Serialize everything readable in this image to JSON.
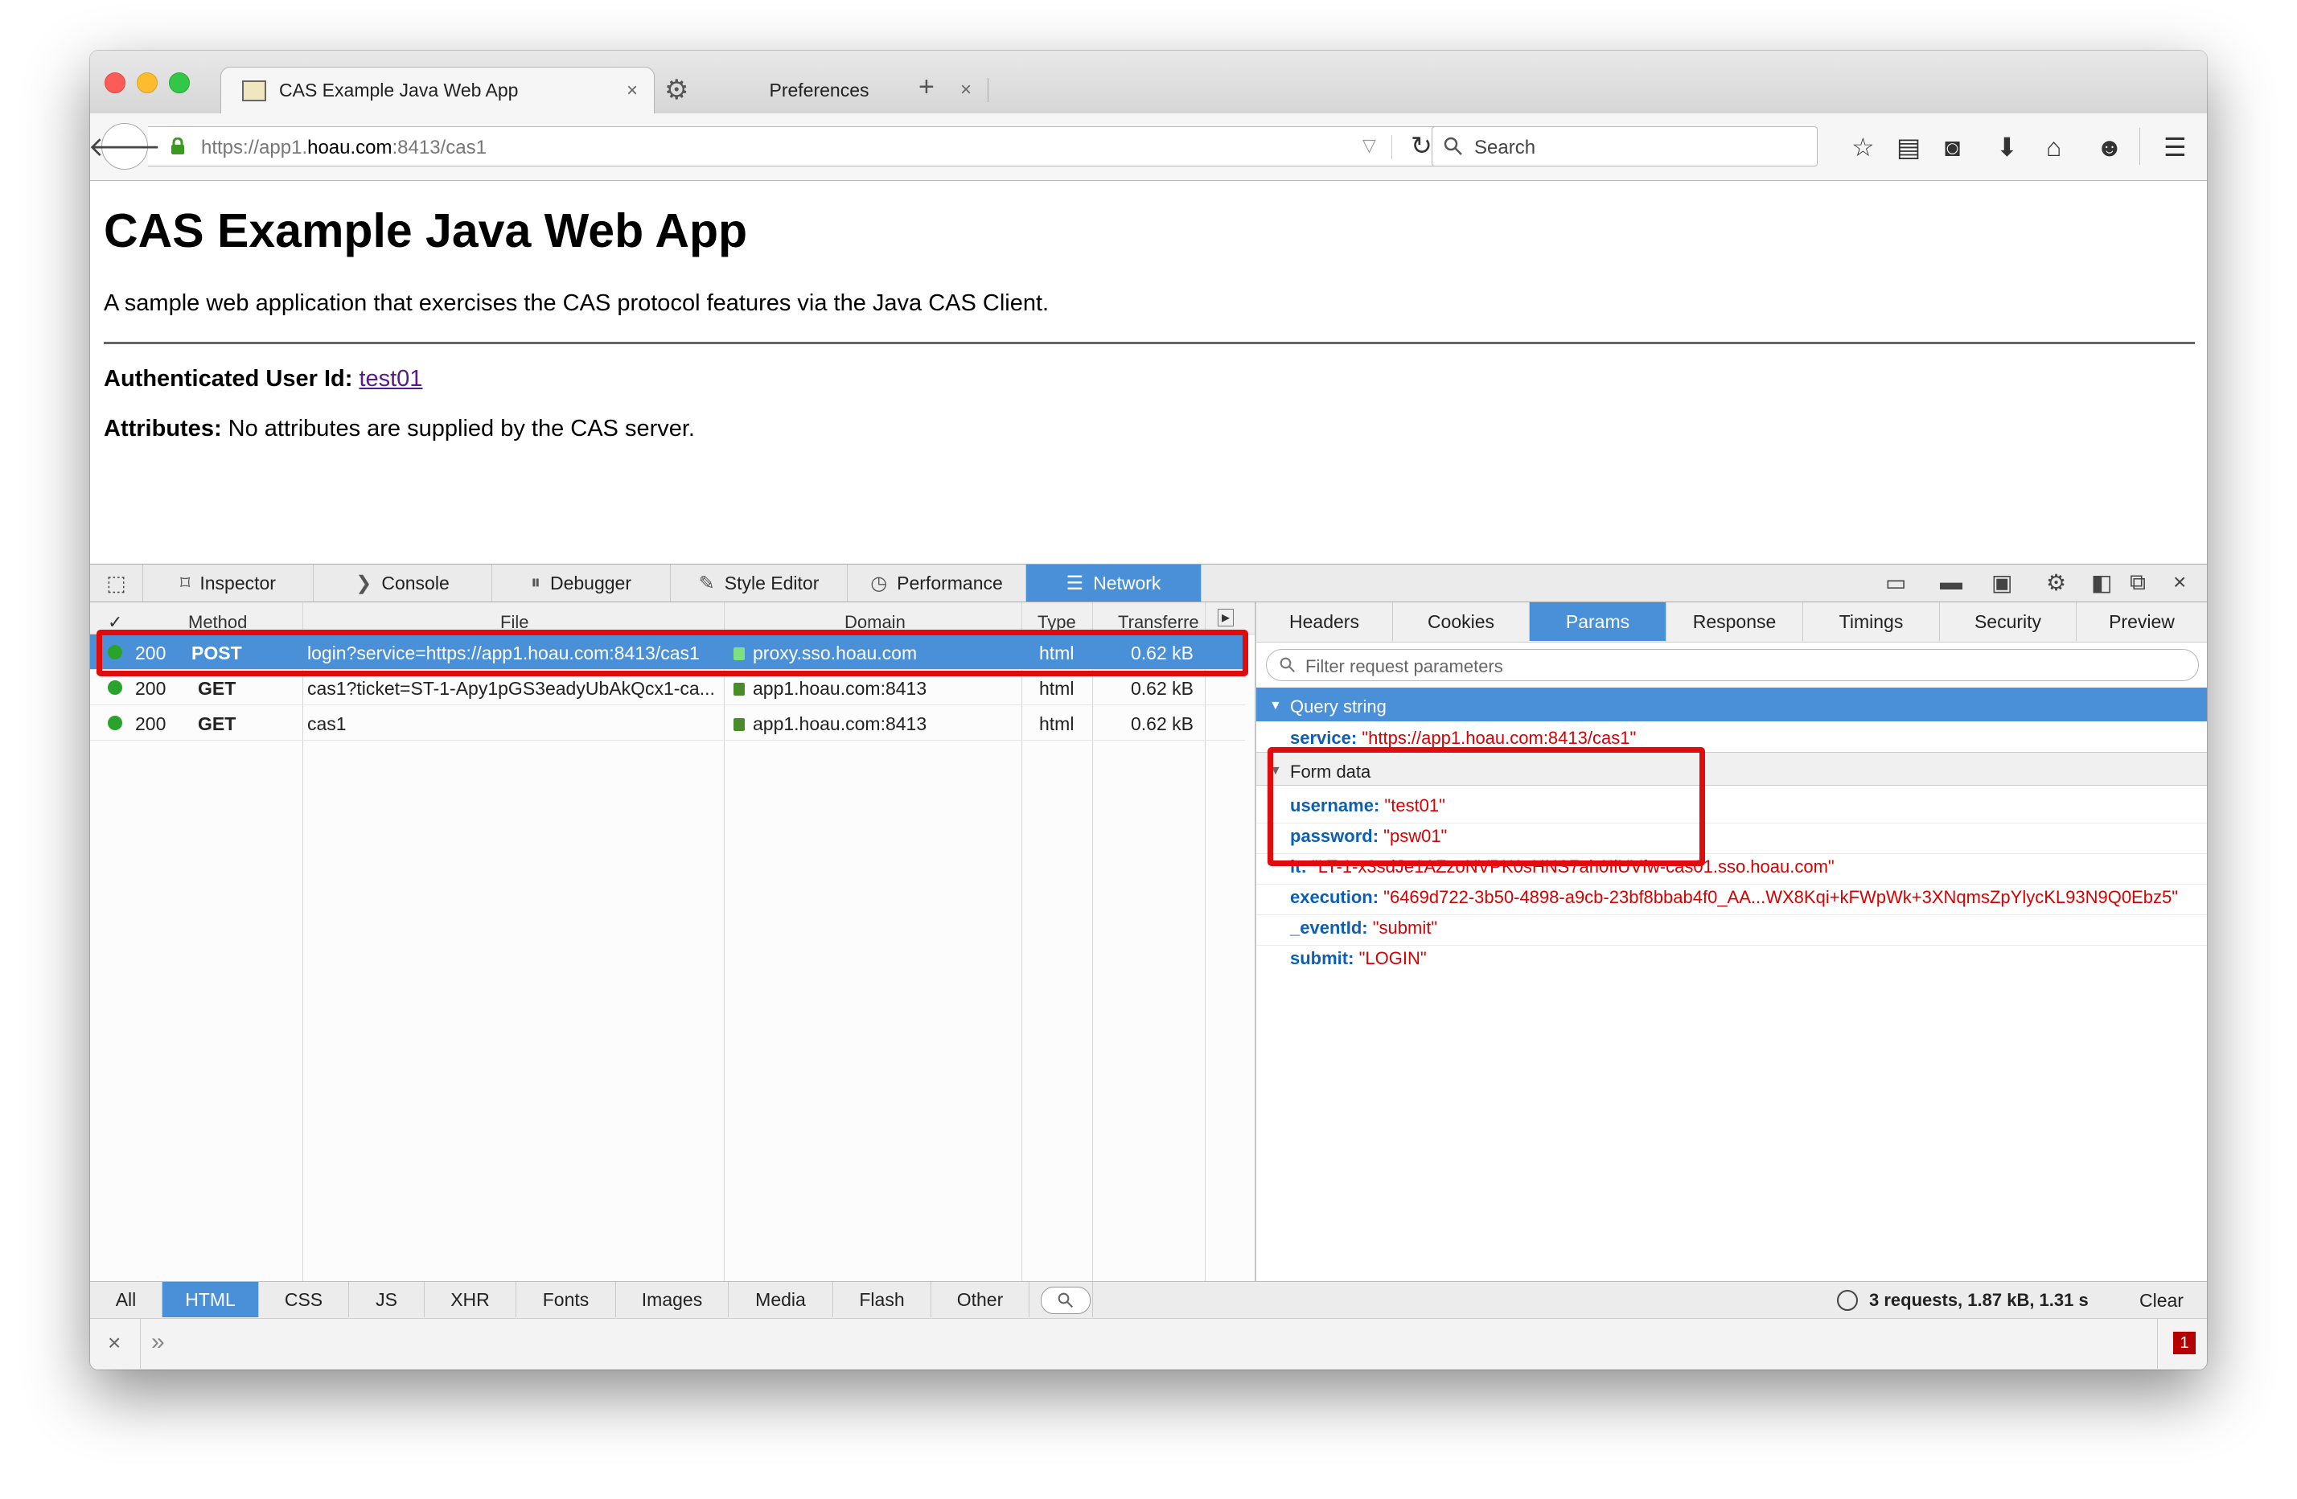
{
  "browser": {
    "tabs": [
      {
        "title": "CAS Example Java Web App",
        "close": "×"
      },
      {
        "title": "Preferences",
        "close": "×"
      }
    ],
    "new_tab": "+",
    "url_prefix": "https://app1.",
    "url_domain": "hoau.com",
    "url_suffix": ":8413/cas1",
    "search_placeholder": "Search",
    "icons": [
      "back-arrow-icon",
      "lock-icon",
      "dropdown-icon",
      "reload-icon",
      "search-icon",
      "star-icon",
      "reading-list-icon",
      "pocket-icon",
      "download-icon",
      "home-icon",
      "chat-icon",
      "menu-icon"
    ]
  },
  "page": {
    "title": "CAS Example Java Web App",
    "description": "A sample web application that exercises the CAS protocol features via the Java CAS Client.",
    "auth_label": "Authenticated User Id:",
    "auth_user": "test01",
    "attr_label": "Attributes:",
    "attr_text": "No attributes are supplied by the CAS server."
  },
  "devtools": {
    "tools": [
      "Inspector",
      "Console",
      "Debugger",
      "Style Editor",
      "Performance",
      "Network"
    ],
    "selected_tool": "Network",
    "columns": {
      "check": "✓",
      "method": "Method",
      "file": "File",
      "domain": "Domain",
      "type": "Type",
      "transferred": "Transferre"
    },
    "requests": [
      {
        "status": "200",
        "method": "POST",
        "file": "login?service=https://app1.hoau.com:8413/cas1",
        "domain": "proxy.sso.hoau.com",
        "type": "html",
        "size": "0.62 kB"
      },
      {
        "status": "200",
        "method": "GET",
        "file": "cas1?ticket=ST-1-Apy1pGS3eadyUbAkQcx1-ca...",
        "domain": "app1.hoau.com:8413",
        "type": "html",
        "size": "0.62 kB"
      },
      {
        "status": "200",
        "method": "GET",
        "file": "cas1",
        "domain": "app1.hoau.com:8413",
        "type": "html",
        "size": "0.62 kB"
      }
    ],
    "detail_tabs": [
      "Headers",
      "Cookies",
      "Params",
      "Response",
      "Timings",
      "Security",
      "Preview"
    ],
    "selected_detail_tab": "Params",
    "filter_placeholder": "Filter request parameters",
    "query_string_label": "Query string",
    "query_params": [
      {
        "key": "service",
        "value": "\"https://app1.hoau.com:8413/cas1\""
      }
    ],
    "form_data_label": "Form data",
    "form_params": [
      {
        "key": "username",
        "value": "\"test01\""
      },
      {
        "key": "password",
        "value": "\"psw01\""
      },
      {
        "key": "lt",
        "value": "\"LT-1-x3sdJe1AZzoNVPK0sHNS7ah0IlUVfw-cas01.sso.hoau.com\""
      },
      {
        "key": "execution",
        "value": "\"6469d722-3b50-4898-a9cb-23bf8bbab4f0_AA...WX8Kqi+kFWpWk+3XNqmsZpYlycKL93N9Q0Ebz5\""
      },
      {
        "key": "_eventId",
        "value": "\"submit\""
      },
      {
        "key": "submit",
        "value": "\"LOGIN\""
      }
    ],
    "filter_buttons": [
      "All",
      "HTML",
      "CSS",
      "JS",
      "XHR",
      "Fonts",
      "Images",
      "Media",
      "Flash",
      "Other"
    ],
    "selected_filter": "HTML",
    "summary": "3 requests, 1.87 kB, 1.31 s",
    "clear": "Clear",
    "console_close": "×",
    "console_prompt": "»",
    "error_count": "1"
  },
  "colors": {
    "accent": "#4a90d9",
    "highlight_box": "#e10b0b",
    "param_key": "#0b5fb5",
    "param_value": "#d80000",
    "status_ok": "#29a329"
  }
}
